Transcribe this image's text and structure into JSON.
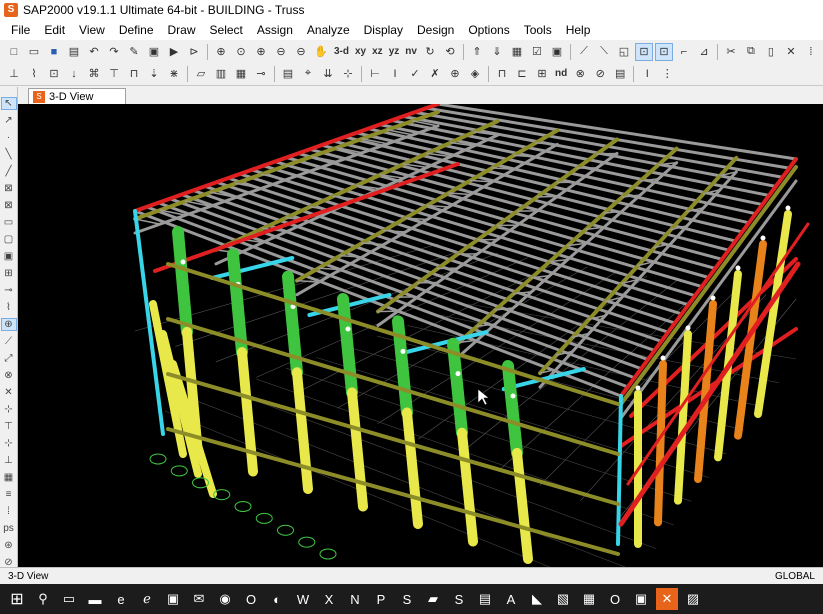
{
  "window": {
    "title": "SAP2000 v19.1.1 Ultimate 64-bit - BUILDING - Truss",
    "icon": "sap2000-logo-icon"
  },
  "menu": [
    "File",
    "Edit",
    "View",
    "Define",
    "Draw",
    "Select",
    "Assign",
    "Analyze",
    "Display",
    "Design",
    "Options",
    "Tools",
    "Help"
  ],
  "toolbar1": {
    "view_3d": "3-d",
    "view_xy": "xy",
    "view_xz": "xz",
    "view_yz": "yz",
    "view_nv": "nv"
  },
  "toolbar2": {
    "nd_label": "nd"
  },
  "tab": {
    "label": "3-D View"
  },
  "status": {
    "left": "3-D View",
    "right": "GLOBAL"
  },
  "colors": {
    "viewport_bg": "#000000",
    "columns_yellow": "#e8e84a",
    "columns_green": "#3ec43e",
    "beams_red": "#e02020",
    "braces_cyan": "#38d4e8",
    "truss_gray": "#9a9a9a",
    "girts_olive": "#8c8c28",
    "orange": "#e8821b"
  }
}
